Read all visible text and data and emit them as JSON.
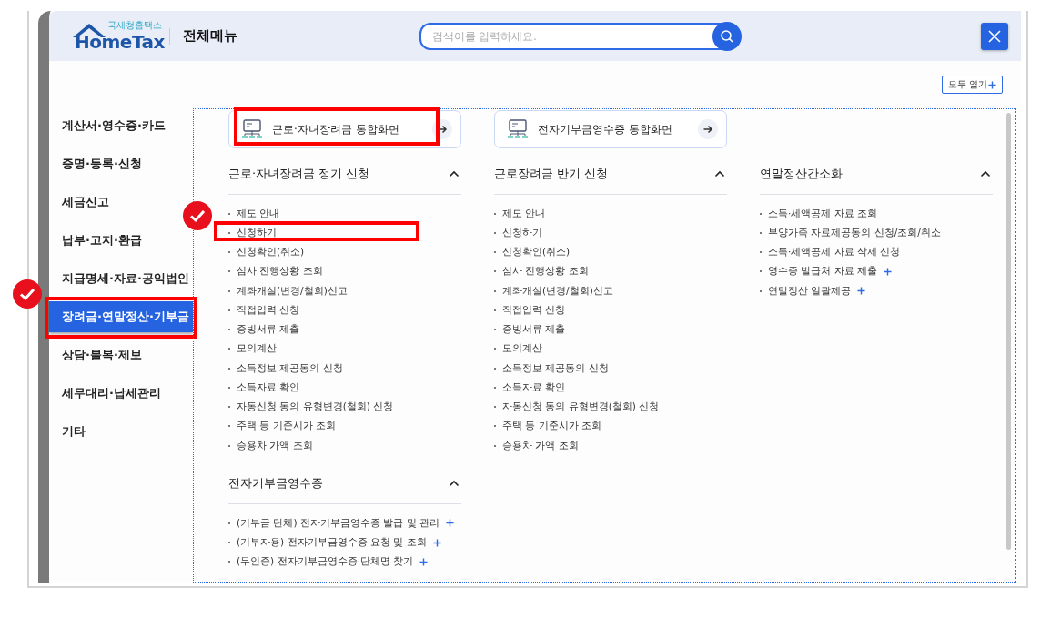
{
  "header": {
    "logo_caption": "국세청홈택스",
    "logo_text": "HomeTax",
    "title": "전체메뉴",
    "search": {
      "placeholder": "검색어를 입력하세요."
    }
  },
  "expand_all_button": {
    "label": "모두 열기"
  },
  "sidebar": {
    "items": [
      {
        "label": "계산서·영수증·카드",
        "selected": false,
        "annotated_box": false,
        "annotated_check": false
      },
      {
        "label": "증명·등록·신청",
        "selected": false,
        "annotated_box": false,
        "annotated_check": false
      },
      {
        "label": "세금신고",
        "selected": false,
        "annotated_box": false,
        "annotated_check": false
      },
      {
        "label": "납부·고지·환급",
        "selected": false,
        "annotated_box": false,
        "annotated_check": false
      },
      {
        "label": "지급명세·자료·공익법인",
        "selected": false,
        "annotated_box": false,
        "annotated_check": false
      },
      {
        "label": "장려금·연말정산·기부금",
        "selected": true,
        "annotated_box": true,
        "annotated_check": true
      },
      {
        "label": "상담·불복·제보",
        "selected": false,
        "annotated_box": false,
        "annotated_check": false
      },
      {
        "label": "세무대리·납세관리",
        "selected": false,
        "annotated_box": false,
        "annotated_check": false
      },
      {
        "label": "기타",
        "selected": false,
        "annotated_box": false,
        "annotated_check": false
      }
    ]
  },
  "shortcuts": [
    {
      "label": "근로·자녀장려금 통합화면",
      "annotated_box": true
    },
    {
      "label": "전자기부금영수증 통합화면",
      "annotated_box": false
    }
  ],
  "sections": [
    {
      "title": "근로·자녀장려금 정기 신청",
      "expanded": true,
      "items": [
        {
          "label": "제도 안내",
          "has_plus": false,
          "annotated_box": false,
          "annotated_check": false
        },
        {
          "label": "신청하기",
          "has_plus": false,
          "annotated_box": true,
          "annotated_check": true
        },
        {
          "label": "신청확인(취소)",
          "has_plus": false,
          "annotated_box": false,
          "annotated_check": false
        },
        {
          "label": "심사 진행상황 조회",
          "has_plus": false,
          "annotated_box": false,
          "annotated_check": false
        },
        {
          "label": "계좌개설(변경/철회)신고",
          "has_plus": false,
          "annotated_box": false,
          "annotated_check": false
        },
        {
          "label": "직접입력 신청",
          "has_plus": false,
          "annotated_box": false,
          "annotated_check": false
        },
        {
          "label": "증빙서류 제출",
          "has_plus": false,
          "annotated_box": false,
          "annotated_check": false
        },
        {
          "label": "모의계산",
          "has_plus": false,
          "annotated_box": false,
          "annotated_check": false
        },
        {
          "label": "소득정보 제공동의 신청",
          "has_plus": false,
          "annotated_box": false,
          "annotated_check": false
        },
        {
          "label": "소득자료 확인",
          "has_plus": false,
          "annotated_box": false,
          "annotated_check": false
        },
        {
          "label": "자동신청 동의 유형변경(철회) 신청",
          "has_plus": false,
          "annotated_box": false,
          "annotated_check": false
        },
        {
          "label": "주택 등 기준시가 조회",
          "has_plus": false,
          "annotated_box": false,
          "annotated_check": false
        },
        {
          "label": "승용차 가액 조회",
          "has_plus": false,
          "annotated_box": false,
          "annotated_check": false
        }
      ]
    },
    {
      "title": "근로장려금 반기 신청",
      "expanded": true,
      "items": [
        {
          "label": "제도 안내",
          "has_plus": false,
          "annotated_box": false,
          "annotated_check": false
        },
        {
          "label": "신청하기",
          "has_plus": false,
          "annotated_box": false,
          "annotated_check": false
        },
        {
          "label": "신청확인(취소)",
          "has_plus": false,
          "annotated_box": false,
          "annotated_check": false
        },
        {
          "label": "심사 진행상황 조회",
          "has_plus": false,
          "annotated_box": false,
          "annotated_check": false
        },
        {
          "label": "계좌개설(변경/철회)신고",
          "has_plus": false,
          "annotated_box": false,
          "annotated_check": false
        },
        {
          "label": "직접입력 신청",
          "has_plus": false,
          "annotated_box": false,
          "annotated_check": false
        },
        {
          "label": "증빙서류 제출",
          "has_plus": false,
          "annotated_box": false,
          "annotated_check": false
        },
        {
          "label": "모의계산",
          "has_plus": false,
          "annotated_box": false,
          "annotated_check": false
        },
        {
          "label": "소득정보 제공동의 신청",
          "has_plus": false,
          "annotated_box": false,
          "annotated_check": false
        },
        {
          "label": "소득자료 확인",
          "has_plus": false,
          "annotated_box": false,
          "annotated_check": false
        },
        {
          "label": "자동신청 동의 유형변경(철회) 신청",
          "has_plus": false,
          "annotated_box": false,
          "annotated_check": false
        },
        {
          "label": "주택 등 기준시가 조회",
          "has_plus": false,
          "annotated_box": false,
          "annotated_check": false
        },
        {
          "label": "승용차 가액 조회",
          "has_plus": false,
          "annotated_box": false,
          "annotated_check": false
        }
      ]
    },
    {
      "title": "연말정산간소화",
      "expanded": true,
      "items": [
        {
          "label": "소득·세액공제 자료 조회",
          "has_plus": false,
          "annotated_box": false,
          "annotated_check": false
        },
        {
          "label": "부양가족 자료제공동의 신청/조회/취소",
          "has_plus": false,
          "annotated_box": false,
          "annotated_check": false
        },
        {
          "label": "소득·세액공제 자료 삭제 신청",
          "has_plus": false,
          "annotated_box": false,
          "annotated_check": false
        },
        {
          "label": "영수증 발급처 자료 제출",
          "has_plus": true,
          "annotated_box": false,
          "annotated_check": false
        },
        {
          "label": "연말정산 일괄제공",
          "has_plus": true,
          "annotated_box": false,
          "annotated_check": false
        }
      ]
    },
    {
      "title": "전자기부금영수증",
      "expanded": true,
      "items": [
        {
          "label": "(기부금 단체) 전자기부금영수증 발급 및 관리",
          "has_plus": true,
          "annotated_box": false,
          "annotated_check": false
        },
        {
          "label": "(기부자용) 전자기부금영수증 요청 및 조회",
          "has_plus": true,
          "annotated_box": false,
          "annotated_check": false
        },
        {
          "label": "(무인증) 전자기부금영수증 단체명 찾기",
          "has_plus": true,
          "annotated_box": false,
          "annotated_check": false
        }
      ]
    }
  ]
}
